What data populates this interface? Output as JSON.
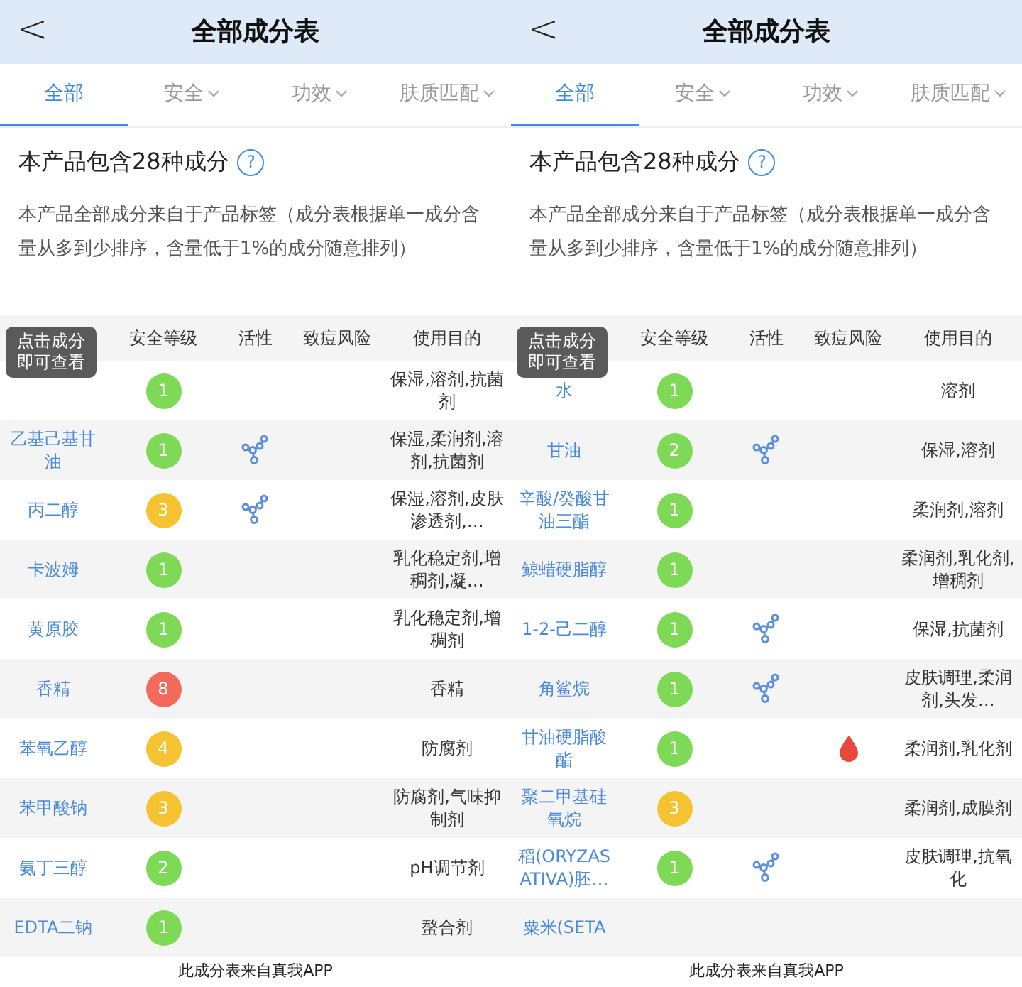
{
  "panels": [
    {
      "header": {
        "back": "<",
        "title": "全部成分表"
      },
      "tabs": [
        {
          "label": "全部",
          "selected": true,
          "dropdown": false
        },
        {
          "label": "安全",
          "selected": false,
          "dropdown": true
        },
        {
          "label": "功效",
          "selected": false,
          "dropdown": true
        },
        {
          "label": "肤质匹配",
          "selected": false,
          "dropdown": true
        }
      ],
      "summary": {
        "title": "本产品包含28种成分",
        "help": "?",
        "description": "本产品全部成分来自于产品标签（成分表根据单一成分含量从多到少排序，含量低于1%的成分随意排列）"
      },
      "table": {
        "columns": [
          "安全等级",
          "活性",
          "致痘风险",
          "使用目的"
        ],
        "tooltip": "点击成分即可查看",
        "rows": [
          {
            "grade": "1",
            "color": "#7ed957",
            "active": false,
            "acne_risk": false,
            "purpose": "保湿,溶剂,抗菌剂"
          },
          {
            "name": "乙基己基甘油",
            "grade": "1",
            "color": "#7ed957",
            "active": true,
            "acne_risk": false,
            "purpose": "保湿,柔润剂,溶剂,抗菌剂"
          },
          {
            "name": "丙二醇",
            "grade": "3",
            "color": "#f5c232",
            "active": true,
            "acne_risk": false,
            "purpose": "保湿,溶剂,皮肤渗透剂,…"
          },
          {
            "name": "卡波姆",
            "grade": "1",
            "color": "#7ed957",
            "active": false,
            "acne_risk": false,
            "purpose": "乳化稳定剂,增稠剂,凝…"
          },
          {
            "name": "黄原胶",
            "grade": "1",
            "color": "#7ed957",
            "active": false,
            "acne_risk": false,
            "purpose": "乳化稳定剂,增稠剂"
          },
          {
            "name": "香精",
            "grade": "8",
            "color": "#f26a5a",
            "active": false,
            "acne_risk": false,
            "purpose": "香精"
          },
          {
            "name": "苯氧乙醇",
            "grade": "4",
            "color": "#f5c232",
            "active": false,
            "acne_risk": false,
            "purpose": "防腐剂"
          },
          {
            "name": "苯甲酸钠",
            "grade": "3",
            "color": "#f5c232",
            "active": false,
            "acne_risk": false,
            "purpose": "防腐剂,气味抑制剂"
          },
          {
            "name": "氨丁三醇",
            "grade": "2",
            "color": "#7ed957",
            "active": false,
            "acne_risk": false,
            "purpose": "pH调节剂"
          },
          {
            "name": "EDTA二钠",
            "grade": "1",
            "color": "#7ed957",
            "active": false,
            "acne_risk": false,
            "purpose": "螯合剂"
          }
        ]
      },
      "footer": "此成分表来自真我APP"
    },
    {
      "header": {
        "back": "<",
        "title": "全部成分表"
      },
      "tabs": [
        {
          "label": "全部",
          "selected": true,
          "dropdown": false
        },
        {
          "label": "安全",
          "selected": false,
          "dropdown": true
        },
        {
          "label": "功效",
          "selected": false,
          "dropdown": true
        },
        {
          "label": "肤质匹配",
          "selected": false,
          "dropdown": true
        }
      ],
      "summary": {
        "title": "本产品包含28种成分",
        "help": "?",
        "description": "本产品全部成分来自于产品标签（成分表根据单一成分含量从多到少排序，含量低于1%的成分随意排列）"
      },
      "table": {
        "columns": [
          "安全等级",
          "活性",
          "致痘风险",
          "使用目的"
        ],
        "tooltip": "点击成分即可查看",
        "rows": [
          {
            "name": "水",
            "grade": "1",
            "color": "#7ed957",
            "active": false,
            "acne_risk": false,
            "purpose": "溶剂"
          },
          {
            "name": "甘油",
            "grade": "2",
            "color": "#7ed957",
            "active": true,
            "acne_risk": false,
            "purpose": "保湿,溶剂"
          },
          {
            "name": "辛酸/癸酸甘油三酯",
            "grade": "1",
            "color": "#7ed957",
            "active": false,
            "acne_risk": false,
            "purpose": "柔润剂,溶剂"
          },
          {
            "name": "鲸蜡硬脂醇",
            "grade": "1",
            "color": "#7ed957",
            "active": false,
            "acne_risk": false,
            "purpose": "柔润剂,乳化剂,增稠剂"
          },
          {
            "name": "1-2-己二醇",
            "grade": "1",
            "color": "#7ed957",
            "active": true,
            "acne_risk": false,
            "purpose": "保湿,抗菌剂"
          },
          {
            "name": "角鲨烷",
            "grade": "1",
            "color": "#7ed957",
            "active": true,
            "acne_risk": false,
            "purpose": "皮肤调理,柔润剂,头发…"
          },
          {
            "name": "甘油硬脂酸酯",
            "grade": "1",
            "color": "#7ed957",
            "active": false,
            "acne_risk": true,
            "purpose": "柔润剂,乳化剂"
          },
          {
            "name": "聚二甲基硅氧烷",
            "grade": "3",
            "color": "#f5c232",
            "active": false,
            "acne_risk": false,
            "purpose": "柔润剂,成膜剂"
          },
          {
            "name": "稻(ORYZASATIVA)胚…",
            "grade": "1",
            "color": "#7ed957",
            "active": true,
            "acne_risk": false,
            "purpose": "皮肤调理,抗氧化"
          },
          {
            "name": "粟米(SETA"
          }
        ]
      },
      "footer": "此成分表来自真我APP"
    }
  ]
}
